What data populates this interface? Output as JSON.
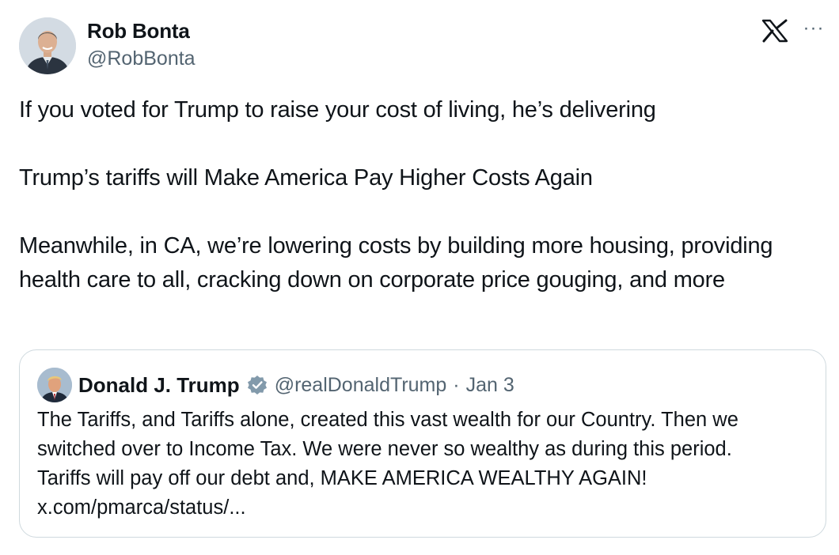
{
  "author": {
    "name": "Rob Bonta",
    "handle": "@RobBonta"
  },
  "icons": {
    "brand": "x-logo-icon",
    "more": "more-options-icon",
    "verified": "verified-badge-icon"
  },
  "more_label": "···",
  "tweet": {
    "paragraphs": [
      "If you voted for Trump to raise your cost of living, he’s delivering",
      "Trump’s tariffs will Make America Pay Higher Costs Again",
      "Meanwhile, in CA, we’re lowering costs by building more housing, providing health care to all, cracking down on corporate price gouging, and more"
    ]
  },
  "quote": {
    "name": "Donald J. Trump",
    "handle": "@realDonaldTrump",
    "separator": "·",
    "date": "Jan 3",
    "lines": [
      "The Tariffs, and Tariffs alone, created this vast wealth for our Country. Then we",
      "switched over to Income Tax. We were never so wealthy as during this period.",
      "Tariffs will pay off our debt and, MAKE AMERICA WEALTHY AGAIN!",
      "x.com/pmarca/status/..."
    ]
  },
  "colors": {
    "text": "#0f1419",
    "secondary": "#536471",
    "border": "#cfd9de",
    "verified": "#829aab"
  }
}
